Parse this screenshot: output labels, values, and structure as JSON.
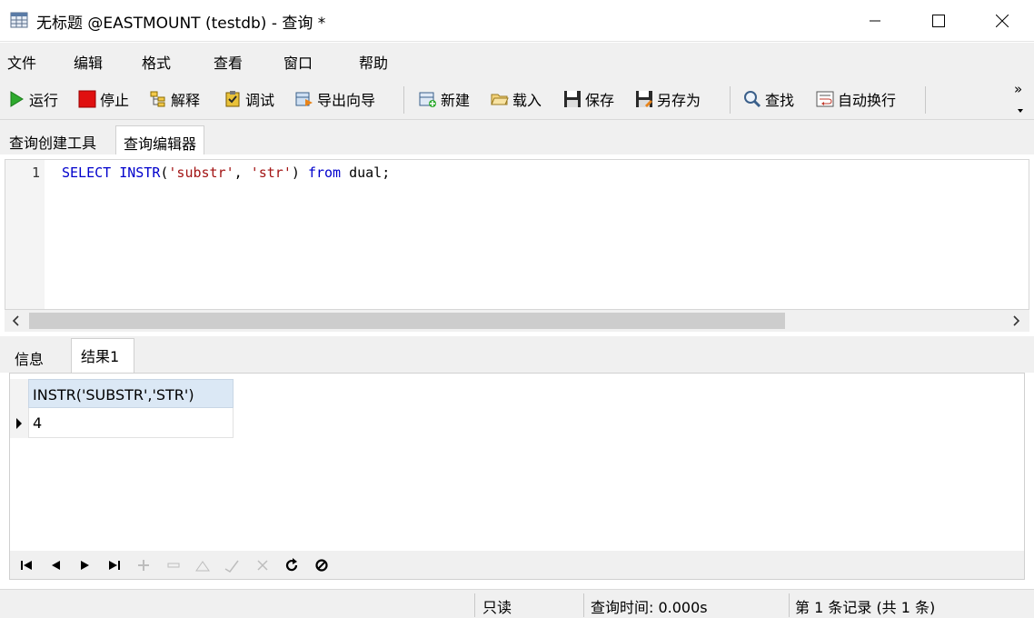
{
  "window": {
    "title": "无标题 @EASTMOUNT (testdb) - 查询 *"
  },
  "menu": [
    "文件",
    "编辑",
    "格式",
    "查看",
    "窗口",
    "帮助"
  ],
  "toolbar": {
    "run": "运行",
    "stop": "停止",
    "explain": "解释",
    "debug": "调试",
    "export_wizard": "导出向导",
    "new": "新建",
    "load": "载入",
    "save": "保存",
    "save_as": "另存为",
    "find": "查找",
    "word_wrap": "自动换行",
    "more": "»"
  },
  "editor_tabs": [
    "查询创建工具",
    "查询编辑器"
  ],
  "editor": {
    "line_number": "1",
    "code": {
      "select": "SELECT",
      "instr": "INSTR",
      "open": "(",
      "arg1": "'substr'",
      "comma": ", ",
      "arg2": "'str'",
      "close": ") ",
      "from": "from",
      "rest": " dual;"
    }
  },
  "result_tabs": [
    "信息",
    "结果1"
  ],
  "grid": {
    "column": "INSTR('SUBSTR','STR')",
    "value": "4"
  },
  "status": {
    "readonly": "只读",
    "query_time": "查询时间: 0.000s",
    "record": "第 1 条记录 (共 1 条)"
  },
  "colors": {
    "keyword": "#0000cc",
    "string": "#a31515",
    "grid_header": "#dbe8f5"
  }
}
